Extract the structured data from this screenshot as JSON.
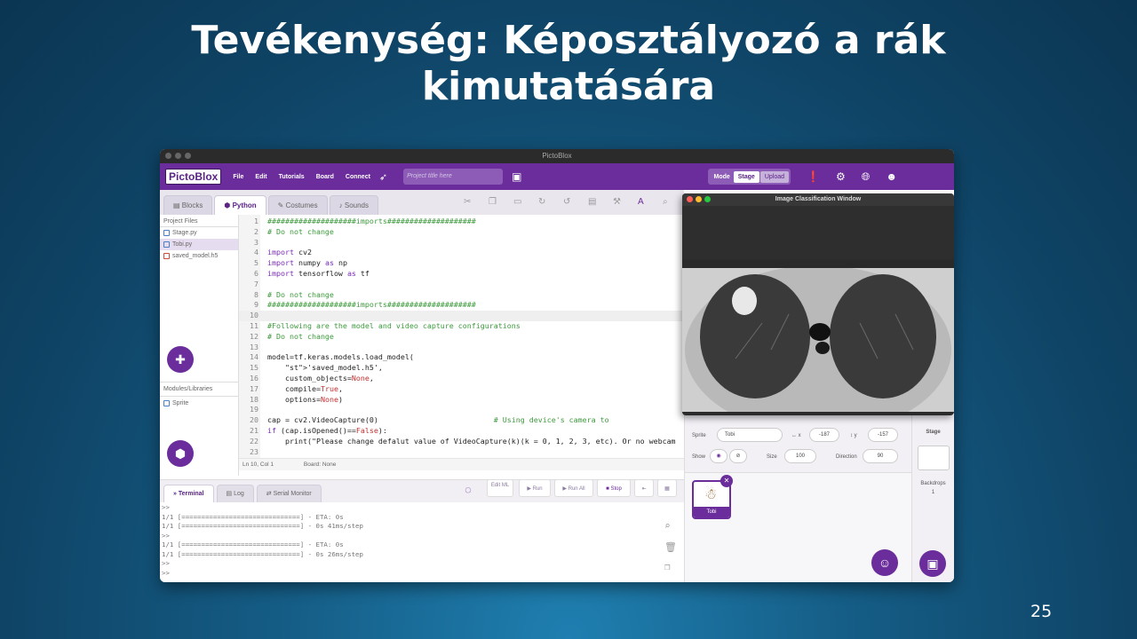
{
  "slide": {
    "title_line1": "Tevékenység: Képosztályozó a rák",
    "title_line2": "kimutatására",
    "page_number": "25"
  },
  "app": {
    "window_title": "PictoBlox",
    "logo": "PictoBlox",
    "menu": [
      "File",
      "Edit",
      "Tutorials",
      "Board",
      "Connect"
    ],
    "project_title_placeholder": "Project title here",
    "mode_label": "Mode",
    "mode_stage": "Stage",
    "mode_upload": "Upload",
    "accent_color": "#6a2d9b"
  },
  "tabs": [
    "Blocks",
    "Python",
    "Costumes",
    "Sounds"
  ],
  "files": {
    "header": "Project Files",
    "items": [
      "Stage.py",
      "Tobi.py",
      "saved_model.h5"
    ],
    "modules_header": "Modules/Libraries",
    "modules": [
      "Sprite"
    ]
  },
  "code": [
    {
      "n": "1",
      "t": "####################imports####################"
    },
    {
      "n": "2",
      "t": "# Do not change"
    },
    {
      "n": "3",
      "t": ""
    },
    {
      "n": "4",
      "t": "import cv2"
    },
    {
      "n": "5",
      "t": "import numpy as np"
    },
    {
      "n": "6",
      "t": "import tensorflow as tf"
    },
    {
      "n": "7",
      "t": ""
    },
    {
      "n": "8",
      "t": "# Do not change"
    },
    {
      "n": "9",
      "t": "####################imports####################"
    },
    {
      "n": "10",
      "t": ""
    },
    {
      "n": "11",
      "t": "#Following are the model and video capture configurations"
    },
    {
      "n": "12",
      "t": "# Do not change"
    },
    {
      "n": "13",
      "t": ""
    },
    {
      "n": "14",
      "t": "model=tf.keras.models.load_model("
    },
    {
      "n": "15",
      "t": "    'saved_model.h5',"
    },
    {
      "n": "16",
      "t": "    custom_objects=None,"
    },
    {
      "n": "17",
      "t": "    compile=True,"
    },
    {
      "n": "18",
      "t": "    options=None)"
    },
    {
      "n": "19",
      "t": ""
    },
    {
      "n": "20",
      "t": "cap = cv2.VideoCapture(0)                          # Using device's camera to"
    },
    {
      "n": "21",
      "t": "if (cap.isOpened()==False):"
    },
    {
      "n": "22",
      "t": "    print(\"Please change defalut value of VideoCapture(k)(k = 0, 1, 2, 3, etc). Or no webcam"
    },
    {
      "n": "23",
      "t": ""
    }
  ],
  "status_bar": {
    "position": "Ln 10, Col 1",
    "board": "Board: None"
  },
  "terminal": {
    "tabs": [
      "Terminal",
      "Log",
      "Serial Monitor"
    ],
    "buttons": [
      "Edit ML",
      "Run",
      "Run All",
      "Stop"
    ],
    "lines": [
      ">>",
      "1/1 [==============================] - ETA: 0s",
      "1/1 [==============================] - 0s 41ms/step",
      ">>",
      "1/1 [==============================] - ETA: 0s",
      "1/1 [==============================] - 0s 26ms/step",
      ">>",
      ">>"
    ]
  },
  "classification_window": {
    "title": "Image Classification Window"
  },
  "sprite": {
    "label_sprite": "Sprite",
    "name": "Tobi",
    "x_label": "x",
    "x": "-187",
    "y_label": "y",
    "y": "-157",
    "show_label": "Show",
    "size_label": "Size",
    "size": "100",
    "direction_label": "Direction",
    "direction": "90",
    "card_label": "Tobi"
  },
  "stage": {
    "label": "Stage",
    "backdrops_label": "Backdrops",
    "backdrops_count": "1"
  }
}
